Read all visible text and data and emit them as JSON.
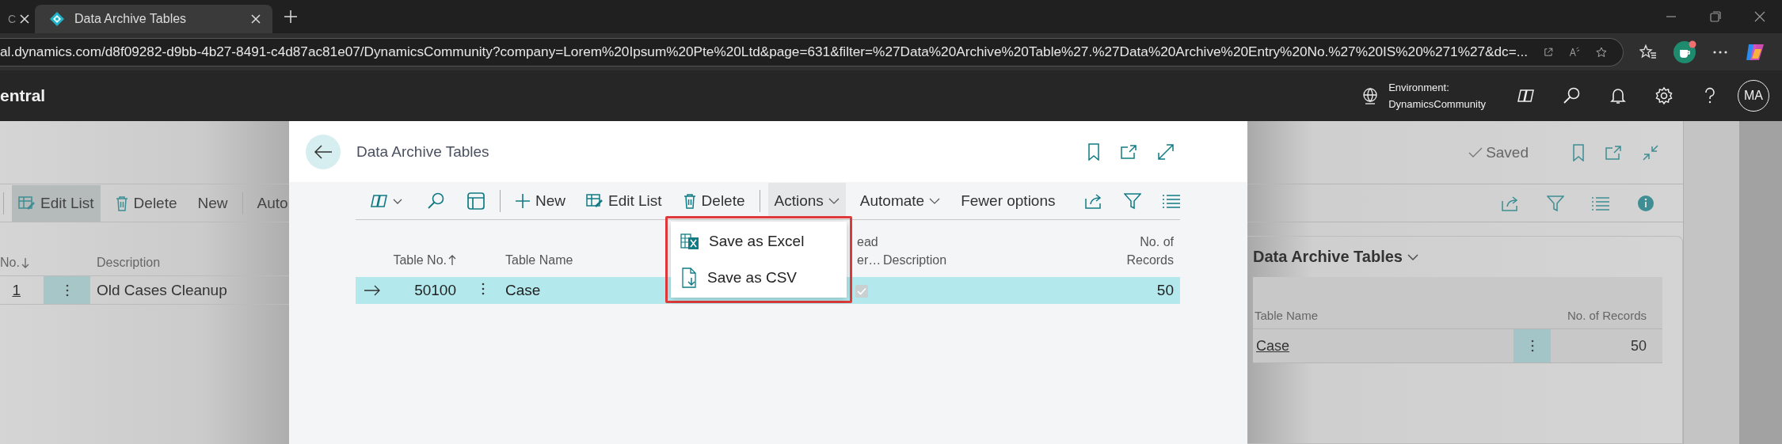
{
  "browser": {
    "tabs": [
      {
        "label": "C",
        "selected": false
      },
      {
        "label": "Data Archive Tables",
        "selected": true
      }
    ],
    "url": "al.dynamics.com/d8f09282-d9bb-4b27-8491-c4d87ac81e07/DynamicsCommunity?company=Lorem%20Ipsum%20Pte%20Ltd&page=631&filter=%27Data%20Archive%20Table%27.%27Data%20Archive%20Entry%20No.%27%20IS%20%271%27&dc=..."
  },
  "app_header": {
    "title": "entral",
    "environment_label": "Environment:",
    "environment_name": "DynamicsCommunity",
    "avatar": "MA"
  },
  "background_page": {
    "status": "Saved",
    "toolbar": [
      {
        "label": "Edit List",
        "kind": "edit",
        "selected": true
      },
      {
        "label": "Delete",
        "kind": "delete",
        "selected": false
      },
      {
        "label": "New",
        "kind": "plain",
        "selected": false
      },
      {
        "label": "Auto",
        "kind": "plain",
        "selected": false
      }
    ],
    "columns": [
      {
        "label": "No.",
        "sorted": true,
        "descending": true
      },
      {
        "label": "Description",
        "sorted": false
      }
    ],
    "rows": [
      {
        "no": "1",
        "description": "Old Cases Cleanup",
        "selected": true
      }
    ],
    "factbox": {
      "title": "Data Archive Tables",
      "columns": [
        "Table Name",
        "No. of Records"
      ],
      "rows": [
        {
          "table_name": "Case",
          "records": "50"
        }
      ]
    }
  },
  "dialog": {
    "title": "Data Archive Tables",
    "toolbar": [
      {
        "label": "New",
        "kind": "add",
        "selected": false
      },
      {
        "label": "Edit List",
        "kind": "edit",
        "selected": false
      },
      {
        "label": "Delete",
        "kind": "delete",
        "selected": false
      },
      {
        "label": "Actions",
        "kind": "menu",
        "selected": true
      },
      {
        "label": "Automate",
        "kind": "menu",
        "selected": false
      },
      {
        "label": "Fewer options",
        "kind": "plain",
        "selected": false
      }
    ],
    "columns": [
      {
        "label": "Table No.",
        "sorted": true,
        "descending": false
      },
      {
        "label": "Table Name",
        "sorted": false
      },
      {
        "label": "ead\ner…",
        "sorted": false
      },
      {
        "label": "Description",
        "sorted": false
      },
      {
        "label": "No. of Records",
        "sorted": false
      }
    ],
    "rows": [
      {
        "table_no": "50100",
        "table_name": "Case",
        "checked": true,
        "records": "50",
        "selected": true
      }
    ],
    "actions_menu": [
      {
        "label": "Save as Excel",
        "kind": "excel"
      },
      {
        "label": "Save as CSV",
        "kind": "csv"
      }
    ]
  }
}
